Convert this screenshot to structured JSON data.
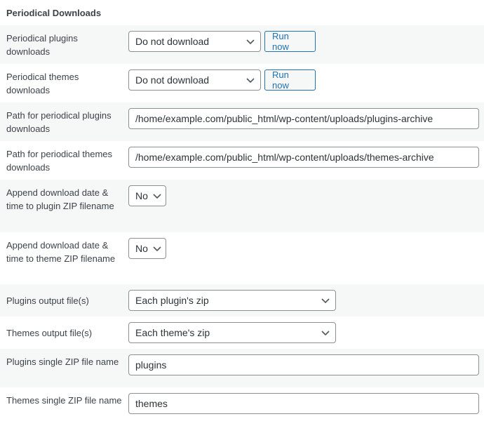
{
  "section": {
    "title": "Periodical Downloads"
  },
  "rows": {
    "plugins_schedule": {
      "label": "Periodical plugins downloads",
      "value": "Do not download",
      "button": "Run now"
    },
    "themes_schedule": {
      "label": "Periodical themes downloads",
      "value": "Do not download",
      "button": "Run now"
    },
    "plugins_path": {
      "label": "Path for periodical plugins downloads",
      "value": "/home/example.com/public_html/wp-content/uploads/plugins-archive"
    },
    "themes_path": {
      "label": "Path for periodical themes downloads",
      "value": "/home/example.com/public_html/wp-content/uploads/themes-archive"
    },
    "plugin_append_date": {
      "label": "Append download date & time to plugin ZIP filename",
      "value": "No"
    },
    "theme_append_date": {
      "label": "Append download date & time to theme ZIP filename",
      "value": "No"
    },
    "plugins_output": {
      "label": "Plugins output file(s)",
      "value": "Each plugin's zip"
    },
    "themes_output": {
      "label": "Themes output file(s)",
      "value": "Each theme's zip"
    },
    "plugins_zip_name": {
      "label": "Plugins single ZIP file name",
      "value": "plugins"
    },
    "themes_zip_name": {
      "label": "Themes single ZIP file name",
      "value": "themes"
    }
  },
  "colors": {
    "accent": "#2271b1",
    "row_alt_bg": "#f6f7f7",
    "border": "#8c8f94",
    "text": "#3c434a"
  }
}
